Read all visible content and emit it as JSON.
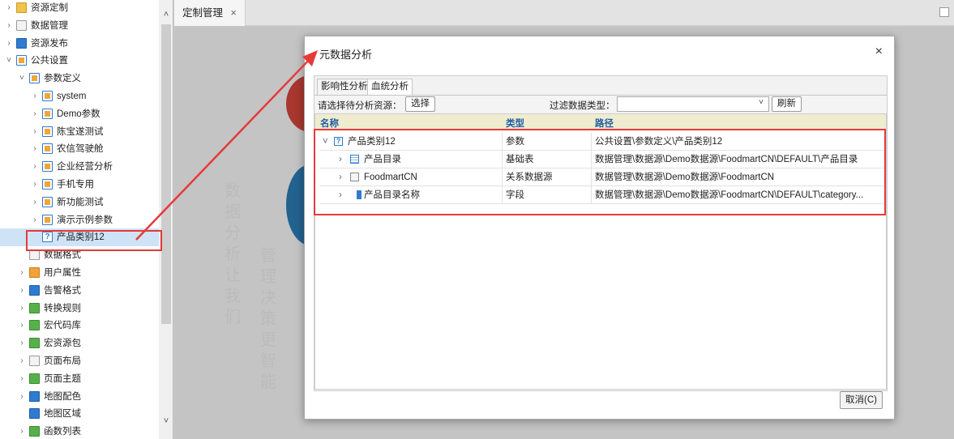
{
  "tree": {
    "items": [
      {
        "label": "资源定制",
        "chev": "›",
        "icon": "folder",
        "indent": 0
      },
      {
        "label": "数据管理",
        "chev": "›",
        "icon": "doc",
        "indent": 0
      },
      {
        "label": "资源发布",
        "chev": "›",
        "icon": "blue",
        "indent": 0
      },
      {
        "label": "公共设置",
        "chev": "˅",
        "icon": "param",
        "indent": 0
      },
      {
        "label": "参数定义",
        "chev": "˅",
        "icon": "param",
        "indent": 1
      },
      {
        "label": "system",
        "chev": "›",
        "icon": "param",
        "indent": 2
      },
      {
        "label": "Demo参数",
        "chev": "›",
        "icon": "param",
        "indent": 2
      },
      {
        "label": "陈宝遂测试",
        "chev": "›",
        "icon": "param",
        "indent": 2
      },
      {
        "label": "农信驾驶舱",
        "chev": "›",
        "icon": "param",
        "indent": 2
      },
      {
        "label": "企业经营分析",
        "chev": "›",
        "icon": "param",
        "indent": 2
      },
      {
        "label": "手机专用",
        "chev": "›",
        "icon": "param",
        "indent": 2
      },
      {
        "label": "新功能测试",
        "chev": "›",
        "icon": "param",
        "indent": 2
      },
      {
        "label": "演示示例参数",
        "chev": "›",
        "icon": "param",
        "indent": 2
      },
      {
        "label": "产品类别12",
        "chev": "",
        "icon": "qmark",
        "indent": 2,
        "selected": true
      },
      {
        "label": "数据格式",
        "chev": "",
        "icon": "doc",
        "indent": 1
      },
      {
        "label": "用户属性",
        "chev": "›",
        "icon": "orange",
        "indent": 1
      },
      {
        "label": "告警格式",
        "chev": "›",
        "icon": "blue",
        "indent": 1
      },
      {
        "label": "转换规则",
        "chev": "›",
        "icon": "green",
        "indent": 1
      },
      {
        "label": "宏代码库",
        "chev": "›",
        "icon": "green",
        "indent": 1
      },
      {
        "label": "宏资源包",
        "chev": "›",
        "icon": "green",
        "indent": 1
      },
      {
        "label": "页面布局",
        "chev": "›",
        "icon": "doc",
        "indent": 1
      },
      {
        "label": "页面主题",
        "chev": "›",
        "icon": "green",
        "indent": 1
      },
      {
        "label": "地图配色",
        "chev": "›",
        "icon": "blue",
        "indent": 1
      },
      {
        "label": "地图区域",
        "chev": "",
        "icon": "blue",
        "indent": 1
      },
      {
        "label": "函数列表",
        "chev": "›",
        "icon": "green",
        "indent": 1
      }
    ]
  },
  "tabs": {
    "main_label": "定制管理",
    "close_glyph": "×"
  },
  "background": {
    "text_a": "数据分析让我们",
    "text_b": "管理决策更智能"
  },
  "dialog": {
    "title": "元数据分析",
    "close_glyph": "×",
    "tab_impact": "影响性分析",
    "tab_lineage": "血统分析",
    "select_resource_label": "请选择待分析资源：",
    "select_button": "选择",
    "filter_label": "过滤数据类型：",
    "filter_value": "",
    "refresh_button": "刷新",
    "columns": {
      "name": "名称",
      "type": "类型",
      "path": "路径"
    },
    "rows": [
      {
        "expander": "˅",
        "icon": "q",
        "name": "产品类别12",
        "type": "参数",
        "path": "公共设置\\参数定义\\产品类别12",
        "level": 0
      },
      {
        "expander": "›",
        "icon": "table",
        "name": "产品目录",
        "type": "基础表",
        "path": "数据管理\\数据源\\Demo数据源\\FoodmartCN\\DEFAULT\\产品目录",
        "level": 1
      },
      {
        "expander": "›",
        "icon": "db",
        "name": "FoodmartCN",
        "type": "关系数据源",
        "path": "数据管理\\数据源\\Demo数据源\\FoodmartCN",
        "level": 1
      },
      {
        "expander": "›",
        "icon": "field",
        "name": "产品目录名称",
        "type": "字段",
        "path": "数据管理\\数据源\\Demo数据源\\FoodmartCN\\DEFAULT\\category...",
        "level": 1
      }
    ],
    "cancel_button": "取消(C)"
  },
  "colors": {
    "annotation_red": "#e63a3a",
    "header_blue": "#1f5fa6",
    "grid_header_bg": "#efeccf"
  }
}
